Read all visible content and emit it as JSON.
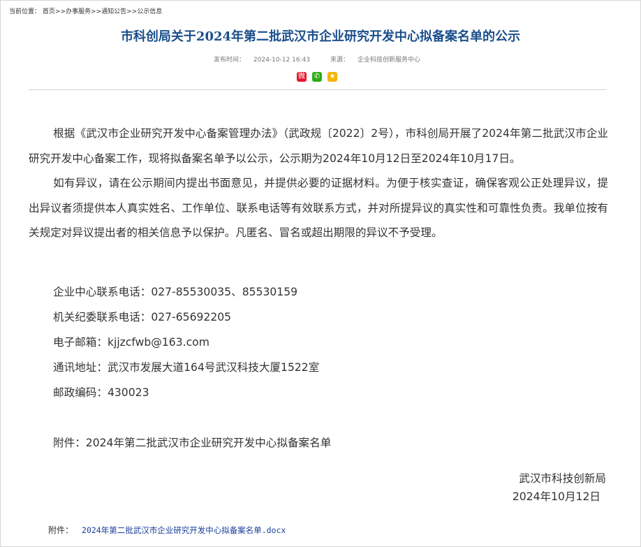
{
  "breadcrumb": {
    "label": "当前位置：",
    "items": [
      "首页",
      "办事服务",
      "通知公告",
      "公示信息"
    ],
    "separator": ">>"
  },
  "article": {
    "title": "市科创局关于2024年第二批武汉市企业研究开发中心拟备案名单的公示",
    "date_label": "发布时间：",
    "date": "2024-10-12 16:43",
    "source_label": "来源：",
    "source": "企业科技创新服务中心",
    "share_icons": [
      "weibo-icon",
      "wechat-icon",
      "qzone-icon"
    ],
    "paragraphs": [
      "根据《武汉市企业研究开发中心备案管理办法》（武政规〔2022〕2号），市科创局开展了2024年第二批武汉市企业研究开发中心备案工作，现将拟备案名单予以公示，公示期为2024年10月12日至2024年10月17日。",
      "如有异议，请在公示期间内提出书面意见，并提供必要的证据材料。为便于核实查证，确保客观公正处理异议，提出异议者须提供本人真实姓名、工作单位、联系电话等有效联系方式，并对所提异议的真实性和可靠性负责。我单位按有关规定对异议提出者的相关信息予以保护。凡匿名、冒名或超出期限的异议不予受理。"
    ],
    "contacts": [
      "企业中心联系电话：027-85530035、85530159",
      "机关纪委联系电话：027-65692205",
      "电子邮箱：kjjzcfwb@163.com",
      "通讯地址：武汉市发展大道164号武汉科技大厦1522室",
      "邮政编码：430023"
    ],
    "attachment_line": "附件：2024年第二批武汉市企业研究开发中心拟备案名单",
    "signature_org": "武汉市科技创新局",
    "signature_date": "2024年10月12日",
    "attachment_label": "附件：",
    "attachment_file": "2024年第二批武汉市企业研究开发中心拟备案名单.docx"
  },
  "colors": {
    "title": "#1a4f8b",
    "link": "#1a3c9c",
    "text": "#333333"
  }
}
